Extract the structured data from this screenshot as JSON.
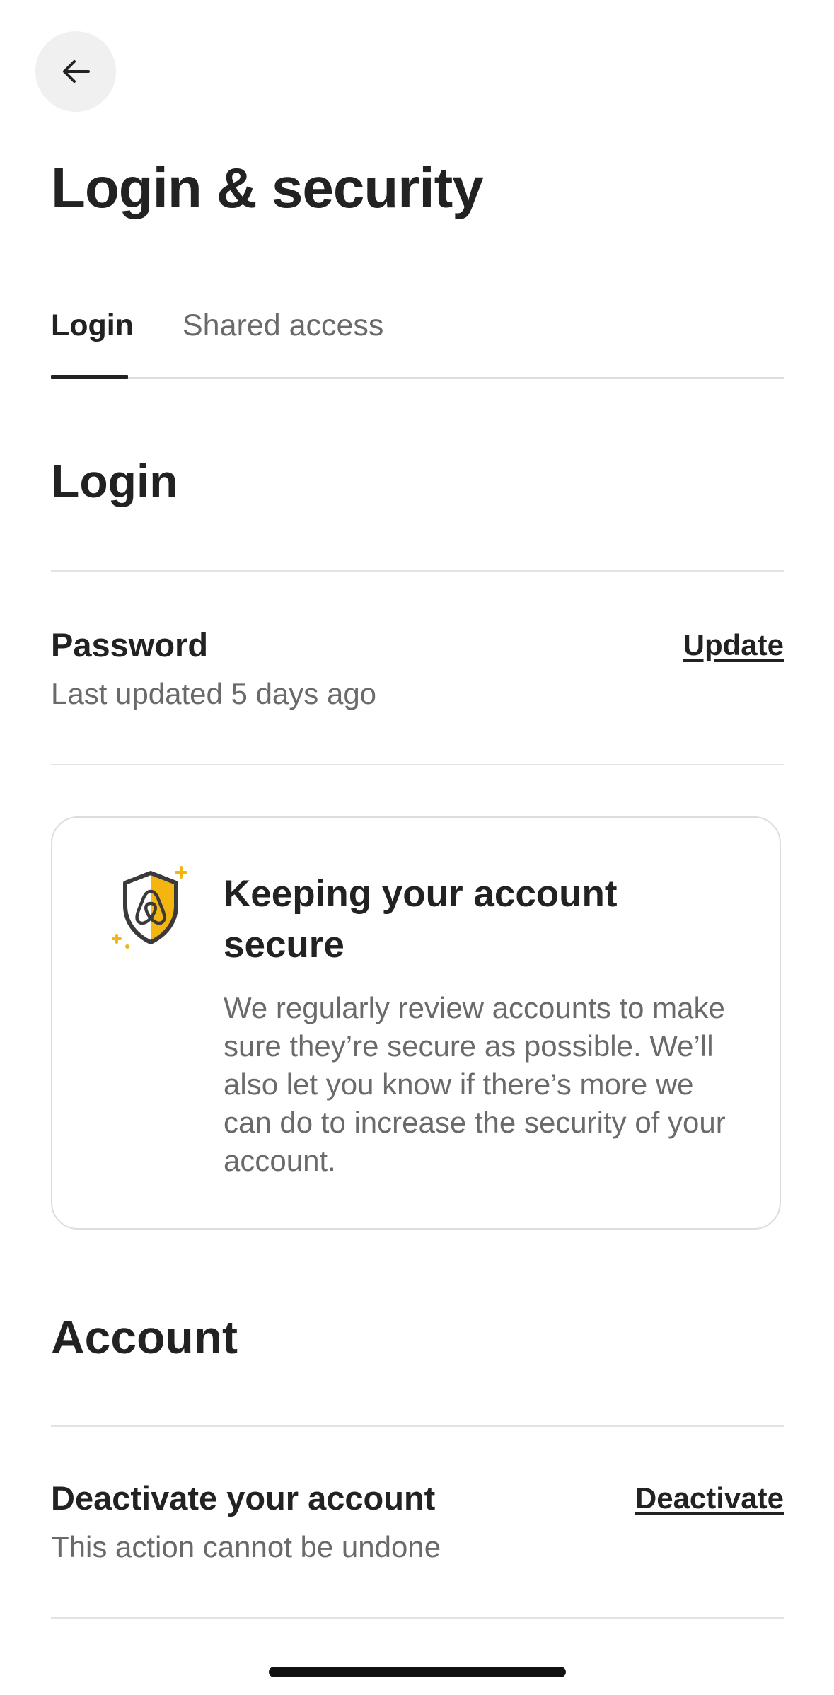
{
  "header": {
    "back_icon": "arrow-left-icon",
    "title": "Login & security"
  },
  "tabs": [
    {
      "label": "Login",
      "active": true
    },
    {
      "label": "Shared access",
      "active": false
    }
  ],
  "login_section": {
    "title": "Login",
    "password": {
      "title": "Password",
      "subtitle": "Last updated 5 days ago",
      "action": "Update"
    }
  },
  "security_card": {
    "icon": "shield-airbnb-icon",
    "title": "Keeping your account secure",
    "body": "We regularly review accounts to make sure they’re secure as possible. We’ll also let you know if there’s more we can do to increase the security of your account."
  },
  "account_section": {
    "title": "Account",
    "deactivate": {
      "title": "Deactivate your account",
      "subtitle": "This action cannot be undone",
      "action": "Deactivate"
    }
  },
  "colors": {
    "accent_yellow": "#F5B511",
    "text_primary": "#222222",
    "text_secondary": "#6A6A6A"
  }
}
